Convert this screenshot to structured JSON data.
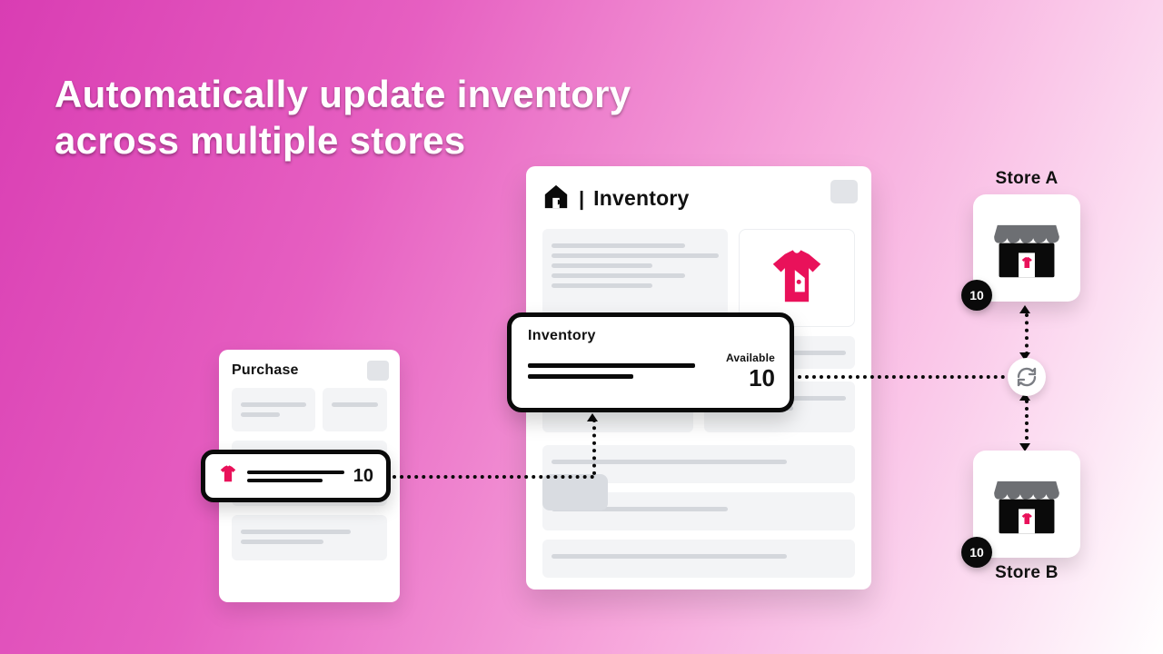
{
  "headline": "Automatically update inventory across multiple stores",
  "purchase_card": {
    "title": "Purchase"
  },
  "purchase_overlay": {
    "quantity": "10"
  },
  "inventory_card": {
    "title": "Inventory"
  },
  "inventory_overlay": {
    "label": "Inventory",
    "available_caption": "Available",
    "available_value": "10"
  },
  "store_a": {
    "label": "Store A",
    "quantity": "10"
  },
  "store_b": {
    "label": "Store B",
    "quantity": "10"
  },
  "colors": {
    "accent": "#e9115a",
    "ink": "#0a0a0a"
  }
}
